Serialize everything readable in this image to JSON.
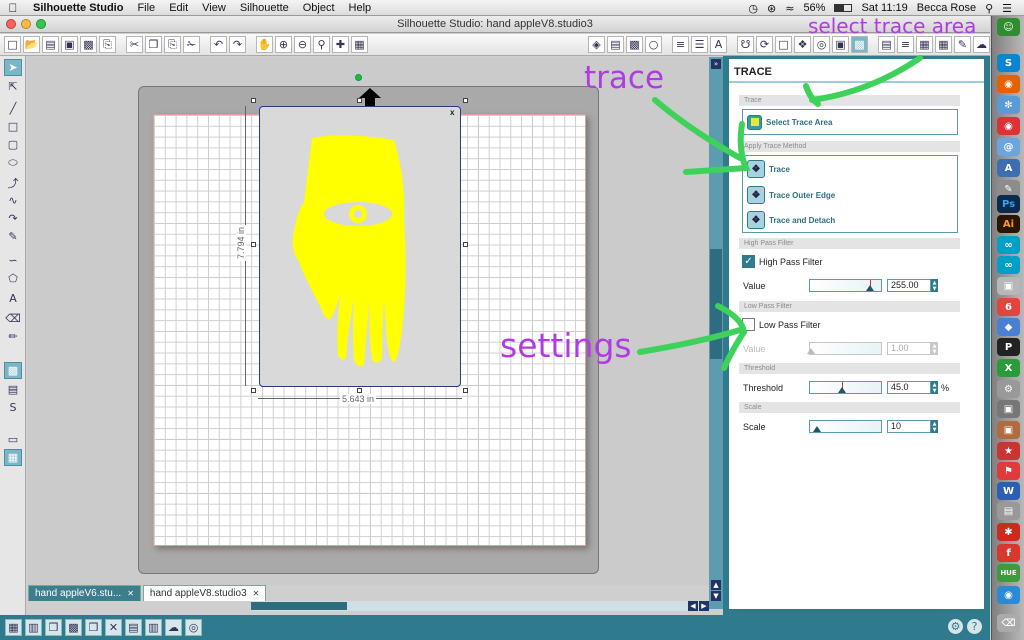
{
  "menubar": {
    "app_name": "Silhouette Studio",
    "menus": [
      "File",
      "Edit",
      "View",
      "Silhouette",
      "Object",
      "Help"
    ],
    "battery": "56%",
    "clock": "Sat 11:19",
    "user": "Becca Rose"
  },
  "window": {
    "title": "Silhouette Studio: hand appleV8.studio3"
  },
  "canvas": {
    "width_label": "5.643 in",
    "height_label": "7.794 in"
  },
  "doc_tabs": [
    {
      "label": "hand appleV6.stu...",
      "active": false
    },
    {
      "label": "hand appleV8.studio3",
      "active": true
    }
  ],
  "panel": {
    "title": "TRACE",
    "section_trace": "Trace",
    "select_trace_area": "Select Trace Area",
    "section_method": "Apply Trace Method",
    "methods": [
      "Trace",
      "Trace Outer Edge",
      "Trace and Detach"
    ],
    "section_high_pass": "High Pass Filter",
    "high_pass_label": "High Pass Filter",
    "high_pass_checked": true,
    "high_pass_value_label": "Value",
    "high_pass_value": "255.00",
    "high_pass_slider_fraction": 0.85,
    "section_low_pass": "Low Pass Filter",
    "low_pass_label": "Low Pass Filter",
    "low_pass_checked": false,
    "low_pass_value_label": "Value",
    "low_pass_value": "1.00",
    "section_threshold": "Threshold",
    "threshold_label": "Threshold",
    "threshold_value": "45.0",
    "threshold_unit": "%",
    "threshold_slider_fraction": 0.45,
    "section_scale": "Scale",
    "scale_label": "Scale",
    "scale_value": "10",
    "scale_slider_fraction": 0.1
  },
  "annotations": {
    "select_trace_area": "select trace area",
    "trace": "trace",
    "settings": "settings"
  },
  "colors": {
    "teal": "#2f7a8c",
    "annotation_purple": "#b13be3",
    "annotation_green": "#3ed25a",
    "image_yellow": "#ffff00"
  }
}
